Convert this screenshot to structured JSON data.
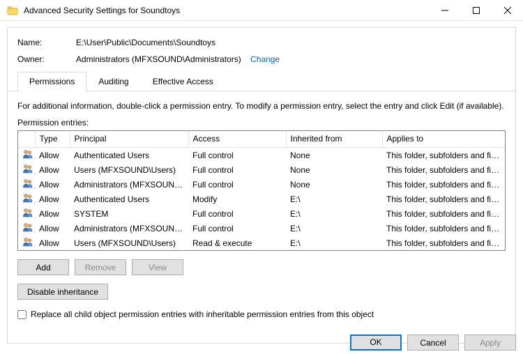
{
  "window": {
    "title": "Advanced Security Settings for Soundtoys"
  },
  "header": {
    "name_label": "Name:",
    "name_value": "E:\\User\\Public\\Documents\\Soundtoys",
    "owner_label": "Owner:",
    "owner_value": "Administrators (MFXSOUND\\Administrators)",
    "change_link": "Change"
  },
  "tabs": {
    "permissions": "Permissions",
    "auditing": "Auditing",
    "effective": "Effective Access"
  },
  "info_text": "For additional information, double-click a permission entry. To modify a permission entry, select the entry and click Edit (if available).",
  "entries_label": "Permission entries:",
  "columns": {
    "type": "Type",
    "principal": "Principal",
    "access": "Access",
    "inherited": "Inherited from",
    "applies": "Applies to"
  },
  "rows": [
    {
      "type": "Allow",
      "principal": "Authenticated Users",
      "access": "Full control",
      "inherited": "None",
      "applies": "This folder, subfolders and files"
    },
    {
      "type": "Allow",
      "principal": "Users (MFXSOUND\\Users)",
      "access": "Full control",
      "inherited": "None",
      "applies": "This folder, subfolders and files"
    },
    {
      "type": "Allow",
      "principal": "Administrators (MFXSOUND\\...",
      "access": "Full control",
      "inherited": "None",
      "applies": "This folder, subfolders and files"
    },
    {
      "type": "Allow",
      "principal": "Authenticated Users",
      "access": "Modify",
      "inherited": "E:\\",
      "applies": "This folder, subfolders and files"
    },
    {
      "type": "Allow",
      "principal": "SYSTEM",
      "access": "Full control",
      "inherited": "E:\\",
      "applies": "This folder, subfolders and files"
    },
    {
      "type": "Allow",
      "principal": "Administrators (MFXSOUND\\...",
      "access": "Full control",
      "inherited": "E:\\",
      "applies": "This folder, subfolders and files"
    },
    {
      "type": "Allow",
      "principal": "Users (MFXSOUND\\Users)",
      "access": "Read & execute",
      "inherited": "E:\\",
      "applies": "This folder, subfolders and files"
    }
  ],
  "buttons": {
    "add": "Add",
    "remove": "Remove",
    "view": "View",
    "disable_inherit": "Disable inheritance",
    "ok": "OK",
    "cancel": "Cancel",
    "apply": "Apply"
  },
  "checkbox_label": "Replace all child object permission entries with inheritable permission entries from this object"
}
